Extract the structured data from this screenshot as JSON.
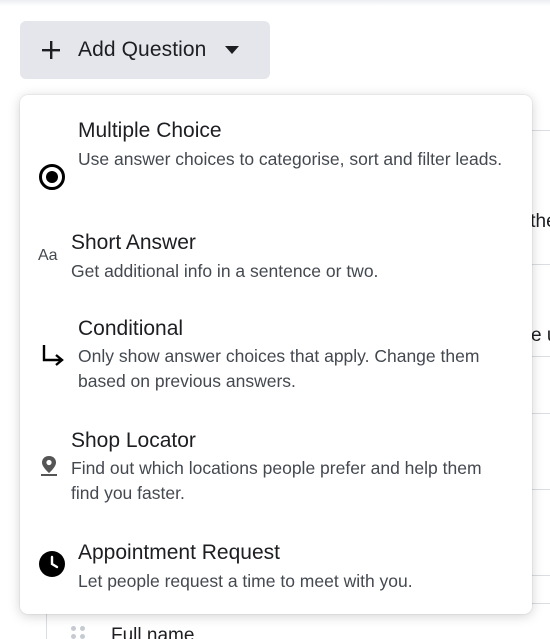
{
  "add_button": {
    "label": "Add Question",
    "plus_icon": "plus-icon",
    "caret_icon": "caret-down-icon"
  },
  "menu": {
    "items": [
      {
        "title": "Multiple Choice",
        "description": "Use answer choices to categorise, sort and filter leads.",
        "icon": "radio-selected-icon"
      },
      {
        "title": "Short Answer",
        "description": "Get additional info in a sentence or two.",
        "icon": "text-aa-icon",
        "icon_text": "Aa"
      },
      {
        "title": "Conditional",
        "description": "Only show answer choices that apply. Change them based on previous answers.",
        "icon": "branch-arrow-icon"
      },
      {
        "title": "Shop Locator",
        "description": "Find out which locations people prefer and help them find you faster.",
        "icon": "location-pin-icon"
      },
      {
        "title": "Appointment Request",
        "description": "Let people request a time to meet with you.",
        "icon": "clock-icon"
      }
    ]
  },
  "background": {
    "fragment_1": ":the",
    "fragment_2": "e u",
    "full_name_label": "Full name"
  },
  "colors": {
    "button_bg": "#e4e6eb",
    "text_primary": "#1c1e21",
    "text_secondary": "#444950",
    "border": "#dadde1"
  }
}
